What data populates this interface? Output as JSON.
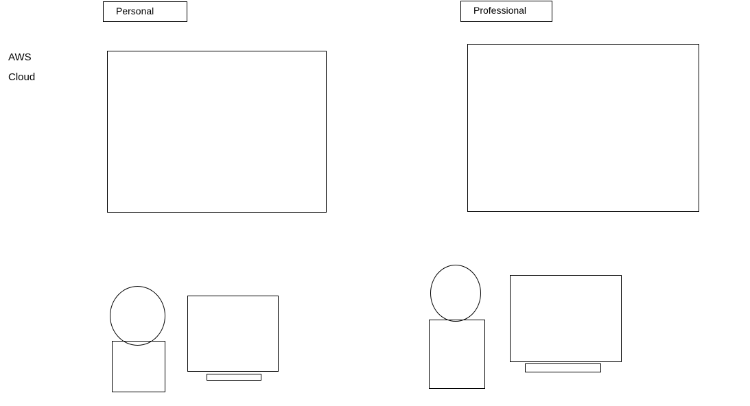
{
  "side_labels": {
    "line1": "AWS",
    "line2": "Cloud"
  },
  "columns": {
    "personal": {
      "title": "Personal"
    },
    "professional": {
      "title": "Professional"
    }
  }
}
